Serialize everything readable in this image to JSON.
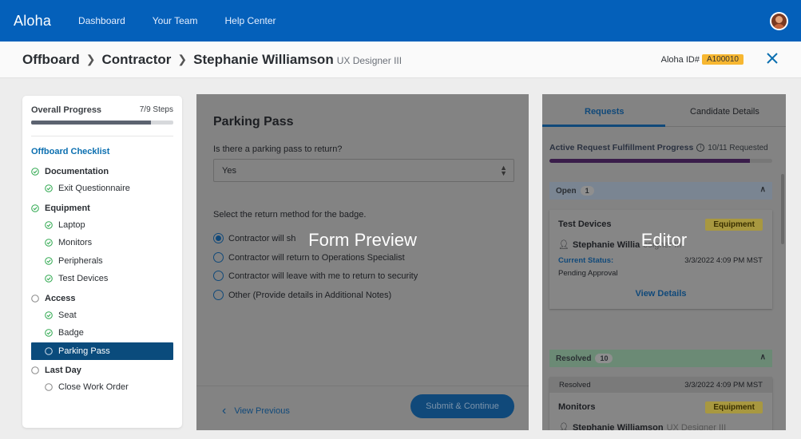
{
  "nav": {
    "logo": "Aloha",
    "links": [
      "Dashboard",
      "Your Team",
      "Help Center"
    ]
  },
  "header": {
    "breadcrumb": [
      "Offboard",
      "Contractor",
      "Stephanie Williamson"
    ],
    "role": "UX Designer III",
    "aloha_id_label": "Aloha ID#",
    "aloha_id": "A100010"
  },
  "sidebar": {
    "progress_label": "Overall Progress",
    "progress_steps": "7/9 Steps",
    "progress_fraction": 0.84,
    "checklist_title": "Offboard Checklist",
    "groups": [
      {
        "label": "Documentation",
        "done": true,
        "items": [
          {
            "label": "Exit Questionnaire",
            "done": true
          }
        ]
      },
      {
        "label": "Equipment",
        "done": true,
        "items": [
          {
            "label": "Laptop",
            "done": true
          },
          {
            "label": "Monitors",
            "done": true
          },
          {
            "label": "Peripherals",
            "done": true
          },
          {
            "label": "Test Devices",
            "done": true
          }
        ]
      },
      {
        "label": "Access",
        "done": false,
        "items": [
          {
            "label": "Seat",
            "done": true
          },
          {
            "label": "Badge",
            "done": true
          },
          {
            "label": "Parking Pass",
            "done": false,
            "selected": true
          }
        ]
      },
      {
        "label": "Last Day",
        "done": false,
        "items": [
          {
            "label": "Close Work Order",
            "done": false
          }
        ]
      }
    ]
  },
  "form": {
    "overlay_label": "Form Preview",
    "title": "Parking Pass",
    "question": "Is there a parking pass to return?",
    "select_value": "Yes",
    "question2": "Select the return method for the badge.",
    "options": [
      "Contractor will sh",
      "Contractor will return to Operations Specialist",
      "Contractor will leave with me to return to security",
      "Other (Provide details in Additional Notes)"
    ],
    "selected_option": 0,
    "prev_label": "View Previous",
    "submit_label": "Submit & Continue"
  },
  "editor": {
    "overlay_label": "Editor",
    "tabs": [
      "Requests",
      "Candidate Details"
    ],
    "fulfillment_label": "Active Request Fulfillment Progress",
    "fulfillment_count": "10/11 Requested",
    "fulfillment_fraction": 0.9,
    "open_label": "Open",
    "open_count": "1",
    "card1": {
      "title": "Test Devices",
      "tag": "Equipment",
      "person": "Stephanie Willia",
      "role": "esigner III",
      "status_label": "Current Status:",
      "status_date": "3/3/2022 4:09 PM MST",
      "status_value": "Pending Approval",
      "action": "View Details"
    },
    "resolved_label": "Resolved",
    "resolved_count": "10",
    "resolved_row": {
      "label": "Resolved",
      "date": "3/3/2022 4:09 PM MST"
    },
    "card2": {
      "title": "Monitors",
      "tag": "Equipment",
      "person": "Stephanie Williamson",
      "role": "UX Designer III"
    }
  },
  "colors": {
    "primary": "#0460ba",
    "accent": "#10497a",
    "badge": "#f7b731",
    "check": "#2fa84f"
  }
}
